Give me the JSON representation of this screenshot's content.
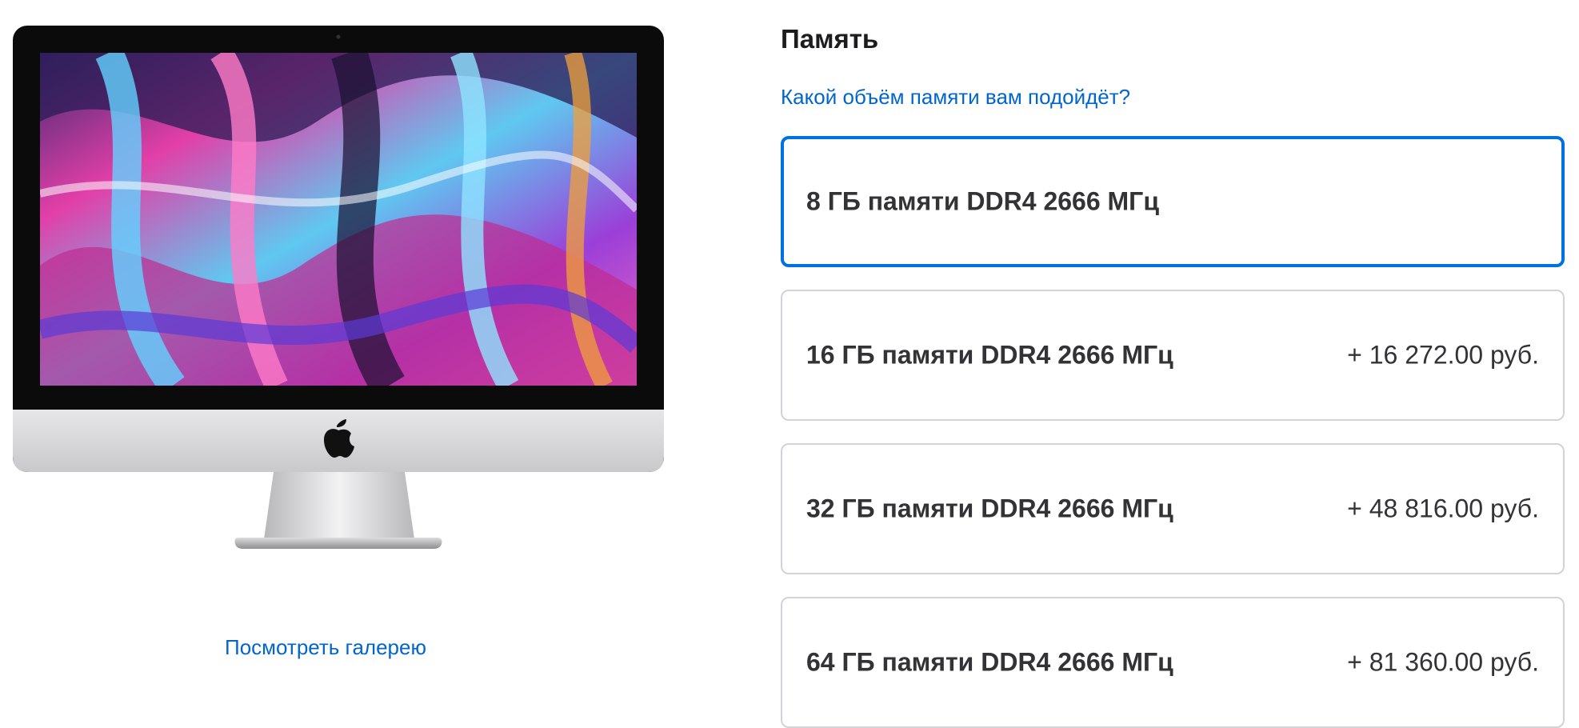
{
  "product": {
    "image_icon": "imac-image",
    "gallery_link": "Посмотреть галерею"
  },
  "memory": {
    "title": "Память",
    "help_link": "Какой объём памяти вам подойдёт?",
    "options": [
      {
        "label": "8 ГБ памяти DDR4 2666 МГц",
        "price": "",
        "selected": true
      },
      {
        "label": "16 ГБ памяти DDR4 2666 МГц",
        "price": "+ 16 272.00 руб.",
        "selected": false
      },
      {
        "label": "32 ГБ памяти DDR4 2666 МГц",
        "price": "+ 48 816.00 руб.",
        "selected": false
      },
      {
        "label": "64 ГБ памяти DDR4 2666 МГц",
        "price": "+ 81 360.00 руб.",
        "selected": false
      }
    ]
  },
  "colors": {
    "link": "#0066cc",
    "selected_border": "#0071e3",
    "border": "#d2d2d7",
    "text": "#1d1d1f"
  }
}
